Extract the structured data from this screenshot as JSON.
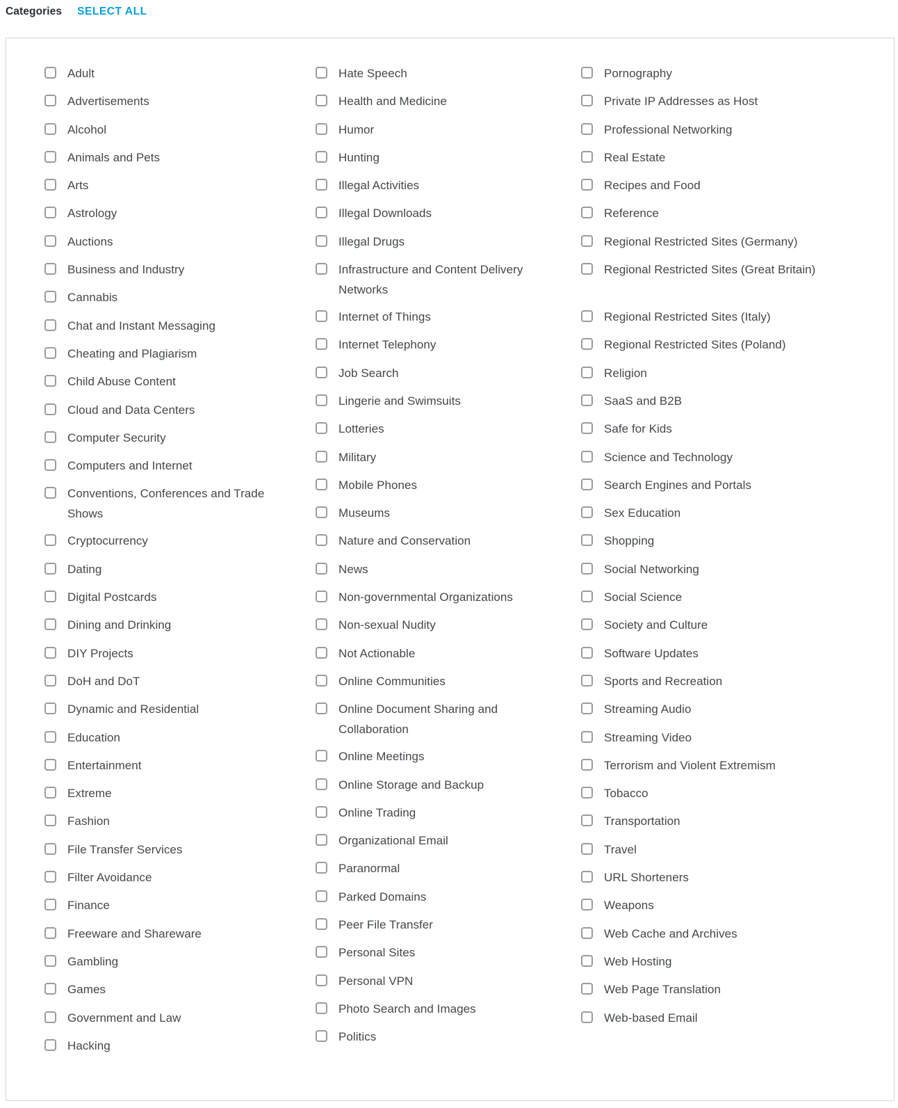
{
  "header": {
    "title": "Categories",
    "select_all_label": "SELECT ALL"
  },
  "colors": {
    "link": "#0a9fda",
    "text": "#44474a",
    "border": "#d7d7d7",
    "checkbox_border": "#9b9b9b"
  },
  "categories": {
    "columns": [
      {
        "items": [
          {
            "label": "Adult",
            "checked": false,
            "wrap": false
          },
          {
            "label": "Advertisements",
            "checked": false,
            "wrap": false
          },
          {
            "label": "Alcohol",
            "checked": false,
            "wrap": false
          },
          {
            "label": "Animals and Pets",
            "checked": false,
            "wrap": false
          },
          {
            "label": "Arts",
            "checked": false,
            "wrap": false
          },
          {
            "label": "Astrology",
            "checked": false,
            "wrap": false
          },
          {
            "label": "Auctions",
            "checked": false,
            "wrap": false
          },
          {
            "label": "Business and Industry",
            "checked": false,
            "wrap": false
          },
          {
            "label": "Cannabis",
            "checked": false,
            "wrap": false
          },
          {
            "label": "Chat and Instant Messaging",
            "checked": false,
            "wrap": false
          },
          {
            "label": "Cheating and Plagiarism",
            "checked": false,
            "wrap": false
          },
          {
            "label": "Child Abuse Content",
            "checked": false,
            "wrap": false
          },
          {
            "label": "Cloud and Data Centers",
            "checked": false,
            "wrap": false
          },
          {
            "label": "Computer Security",
            "checked": false,
            "wrap": false
          },
          {
            "label": "Computers and Internet",
            "checked": false,
            "wrap": false
          },
          {
            "label": "Conventions, Conferences and Trade Shows",
            "checked": false,
            "wrap": true
          },
          {
            "label": "Cryptocurrency",
            "checked": false,
            "wrap": false
          },
          {
            "label": "Dating",
            "checked": false,
            "wrap": false
          },
          {
            "label": "Digital Postcards",
            "checked": false,
            "wrap": false
          },
          {
            "label": "Dining and Drinking",
            "checked": false,
            "wrap": false
          },
          {
            "label": "DIY Projects",
            "checked": false,
            "wrap": false
          },
          {
            "label": "DoH and DoT",
            "checked": false,
            "wrap": false
          },
          {
            "label": "Dynamic and Residential",
            "checked": false,
            "wrap": false
          },
          {
            "label": "Education",
            "checked": false,
            "wrap": false
          },
          {
            "label": "Entertainment",
            "checked": false,
            "wrap": false
          },
          {
            "label": "Extreme",
            "checked": false,
            "wrap": false
          },
          {
            "label": "Fashion",
            "checked": false,
            "wrap": false
          },
          {
            "label": "File Transfer Services",
            "checked": false,
            "wrap": false
          },
          {
            "label": "Filter Avoidance",
            "checked": false,
            "wrap": false
          },
          {
            "label": "Finance",
            "checked": false,
            "wrap": false
          },
          {
            "label": "Freeware and Shareware",
            "checked": false,
            "wrap": false
          },
          {
            "label": "Gambling",
            "checked": false,
            "wrap": false
          },
          {
            "label": "Games",
            "checked": false,
            "wrap": false
          },
          {
            "label": "Government and Law",
            "checked": false,
            "wrap": false
          },
          {
            "label": "Hacking",
            "checked": false,
            "wrap": false
          }
        ]
      },
      {
        "items": [
          {
            "label": "Hate Speech",
            "checked": false,
            "wrap": false
          },
          {
            "label": "Health and Medicine",
            "checked": false,
            "wrap": false
          },
          {
            "label": "Humor",
            "checked": false,
            "wrap": false
          },
          {
            "label": "Hunting",
            "checked": false,
            "wrap": false
          },
          {
            "label": "Illegal Activities",
            "checked": false,
            "wrap": false
          },
          {
            "label": "Illegal Downloads",
            "checked": false,
            "wrap": false
          },
          {
            "label": "Illegal Drugs",
            "checked": false,
            "wrap": false
          },
          {
            "label": "Infrastructure and Content Delivery Networks",
            "checked": false,
            "wrap": true
          },
          {
            "label": "Internet of Things",
            "checked": false,
            "wrap": false
          },
          {
            "label": "Internet Telephony",
            "checked": false,
            "wrap": false
          },
          {
            "label": "Job Search",
            "checked": false,
            "wrap": false
          },
          {
            "label": "Lingerie and Swimsuits",
            "checked": false,
            "wrap": false
          },
          {
            "label": "Lotteries",
            "checked": false,
            "wrap": false
          },
          {
            "label": "Military",
            "checked": false,
            "wrap": false
          },
          {
            "label": "Mobile Phones",
            "checked": false,
            "wrap": false
          },
          {
            "label": "Museums",
            "checked": false,
            "wrap": false
          },
          {
            "label": "Nature and Conservation",
            "checked": false,
            "wrap": false
          },
          {
            "label": "News",
            "checked": false,
            "wrap": false
          },
          {
            "label": "Non-governmental Organizations",
            "checked": false,
            "wrap": false
          },
          {
            "label": "Non-sexual Nudity",
            "checked": false,
            "wrap": false
          },
          {
            "label": "Not Actionable",
            "checked": false,
            "wrap": false
          },
          {
            "label": "Online Communities",
            "checked": false,
            "wrap": false
          },
          {
            "label": "Online Document Sharing and Collaboration",
            "checked": false,
            "wrap": true
          },
          {
            "label": "Online Meetings",
            "checked": false,
            "wrap": false
          },
          {
            "label": "Online Storage and Backup",
            "checked": false,
            "wrap": false
          },
          {
            "label": "Online Trading",
            "checked": false,
            "wrap": false
          },
          {
            "label": "Organizational Email",
            "checked": false,
            "wrap": false
          },
          {
            "label": "Paranormal",
            "checked": false,
            "wrap": false
          },
          {
            "label": "Parked Domains",
            "checked": false,
            "wrap": false
          },
          {
            "label": "Peer File Transfer",
            "checked": false,
            "wrap": false
          },
          {
            "label": "Personal Sites",
            "checked": false,
            "wrap": false
          },
          {
            "label": "Personal VPN",
            "checked": false,
            "wrap": false
          },
          {
            "label": "Photo Search and Images",
            "checked": false,
            "wrap": false
          },
          {
            "label": "Politics",
            "checked": false,
            "wrap": false
          }
        ]
      },
      {
        "items": [
          {
            "label": "Pornography",
            "checked": false,
            "wrap": false
          },
          {
            "label": "Private IP Addresses as Host",
            "checked": false,
            "wrap": false
          },
          {
            "label": "Professional Networking",
            "checked": false,
            "wrap": false
          },
          {
            "label": "Real Estate",
            "checked": false,
            "wrap": false
          },
          {
            "label": "Recipes and Food",
            "checked": false,
            "wrap": false
          },
          {
            "label": "Reference",
            "checked": false,
            "wrap": false
          },
          {
            "label": "Regional Restricted Sites (Germany)",
            "checked": false,
            "wrap": false
          },
          {
            "label": "Regional Restricted Sites (Great Britain)",
            "checked": false,
            "wrap": true
          },
          {
            "label": "Regional Restricted Sites (Italy)",
            "checked": false,
            "wrap": false
          },
          {
            "label": "Regional Restricted Sites (Poland)",
            "checked": false,
            "wrap": false
          },
          {
            "label": "Religion",
            "checked": false,
            "wrap": false
          },
          {
            "label": "SaaS and B2B",
            "checked": false,
            "wrap": false
          },
          {
            "label": "Safe for Kids",
            "checked": false,
            "wrap": false
          },
          {
            "label": "Science and Technology",
            "checked": false,
            "wrap": false
          },
          {
            "label": "Search Engines and Portals",
            "checked": false,
            "wrap": false
          },
          {
            "label": "Sex Education",
            "checked": false,
            "wrap": false
          },
          {
            "label": "Shopping",
            "checked": false,
            "wrap": false
          },
          {
            "label": "Social Networking",
            "checked": false,
            "wrap": false
          },
          {
            "label": "Social Science",
            "checked": false,
            "wrap": false
          },
          {
            "label": "Society and Culture",
            "checked": false,
            "wrap": false
          },
          {
            "label": "Software Updates",
            "checked": false,
            "wrap": false
          },
          {
            "label": "Sports and Recreation",
            "checked": false,
            "wrap": false
          },
          {
            "label": "Streaming Audio",
            "checked": false,
            "wrap": false
          },
          {
            "label": "Streaming Video",
            "checked": false,
            "wrap": false
          },
          {
            "label": "Terrorism and Violent Extremism",
            "checked": false,
            "wrap": false
          },
          {
            "label": "Tobacco",
            "checked": false,
            "wrap": false
          },
          {
            "label": "Transportation",
            "checked": false,
            "wrap": false
          },
          {
            "label": "Travel",
            "checked": false,
            "wrap": false
          },
          {
            "label": "URL Shorteners",
            "checked": false,
            "wrap": false
          },
          {
            "label": "Weapons",
            "checked": false,
            "wrap": false
          },
          {
            "label": "Web Cache and Archives",
            "checked": false,
            "wrap": false
          },
          {
            "label": "Web Hosting",
            "checked": false,
            "wrap": false
          },
          {
            "label": "Web Page Translation",
            "checked": false,
            "wrap": false
          },
          {
            "label": "Web-based Email",
            "checked": false,
            "wrap": false
          }
        ]
      }
    ]
  }
}
